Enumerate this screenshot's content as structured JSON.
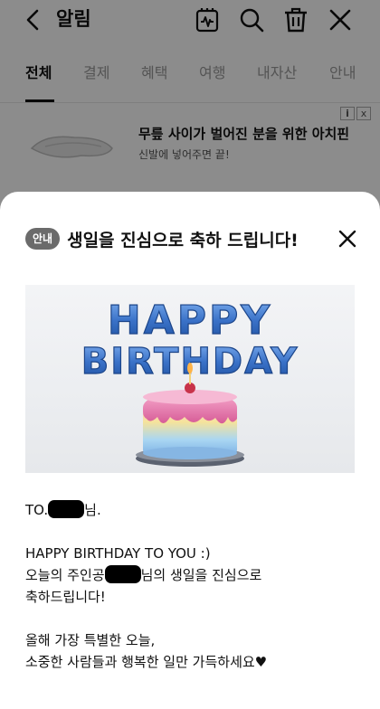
{
  "appbar": {
    "title": "알림",
    "icons": [
      "back-arrow-icon",
      "tag-card-icon",
      "search-icon",
      "trash-icon",
      "close-icon"
    ]
  },
  "tabs": [
    {
      "label": "전체",
      "active": true
    },
    {
      "label": "결제",
      "active": false
    },
    {
      "label": "혜택",
      "active": false
    },
    {
      "label": "여행",
      "active": false
    },
    {
      "label": "내자산",
      "active": false
    },
    {
      "label": "안내",
      "active": false
    }
  ],
  "ad": {
    "title": "무릎 사이가 벌어진 분을 위한 아치핀",
    "subtitle": "신발에 넣어주면 끝!",
    "info_label": "i",
    "close_label": "x"
  },
  "sheet": {
    "badge": "안내",
    "title": "생일을 진심으로 축하 드립니다!",
    "banner": {
      "line1": "HAPPY",
      "line2": "BIRTHDAY"
    },
    "message": {
      "line1_prefix": "TO.",
      "line1_suffix": "님.",
      "line2": "HAPPY BIRTHDAY TO YOU :)",
      "line3_prefix": "오늘의 주인공",
      "line3_suffix": "님의 생일을 진심으로",
      "line4": "축하드립니다!",
      "line5": "올해 가장 특별한 오늘,",
      "line6": "소중한 사람들과 행복한 일만 가득하세요♥"
    }
  },
  "colors": {
    "overlay": "#000000",
    "badge_bg": "#6b6b6b",
    "balloon_blue": "#3a72c8"
  }
}
